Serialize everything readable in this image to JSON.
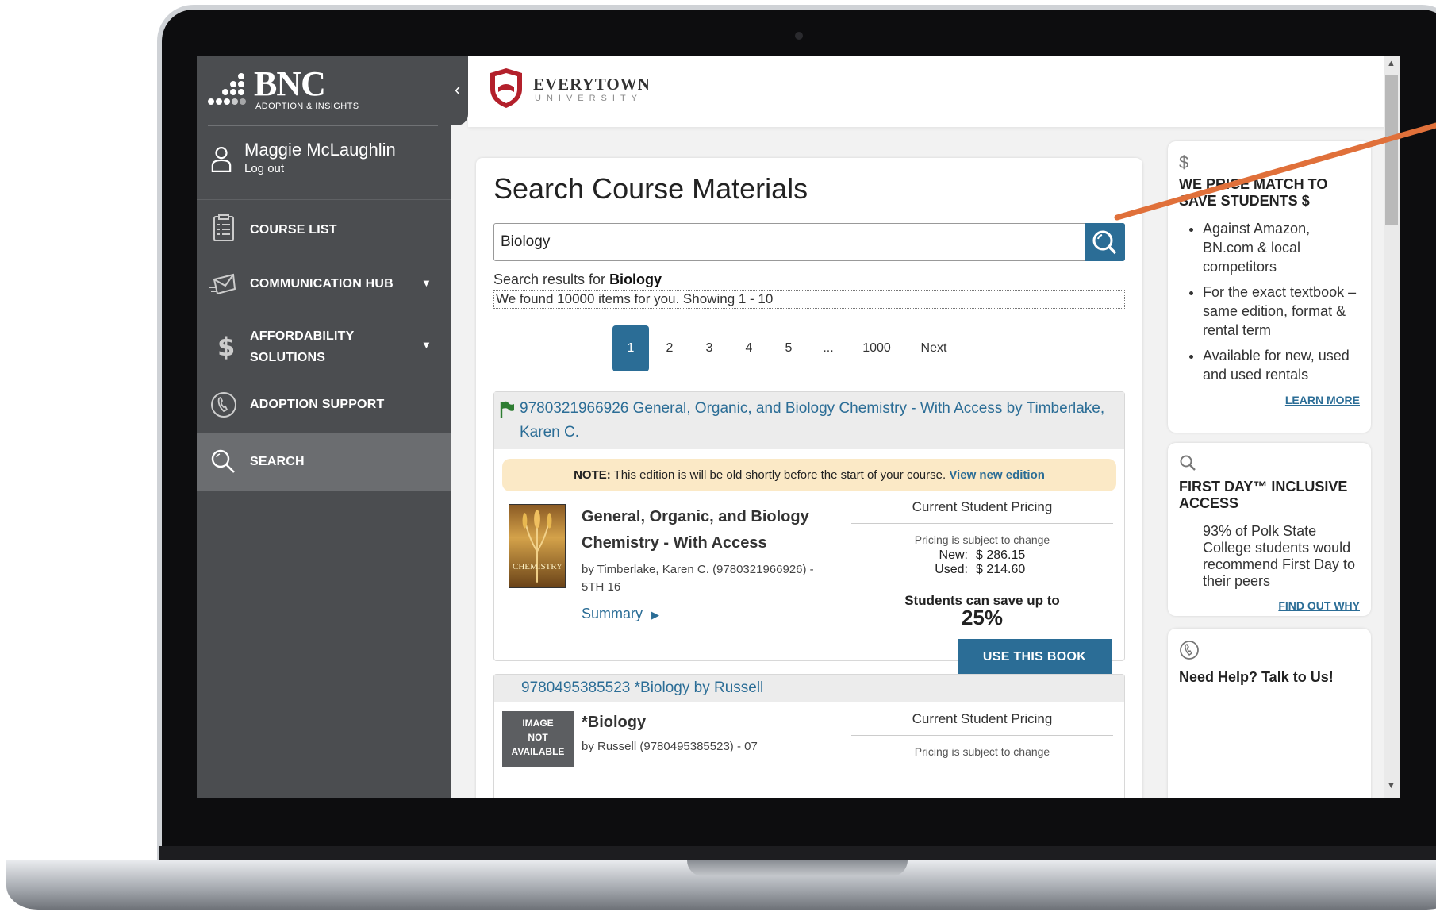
{
  "brand": {
    "name": "BNC",
    "subtitle": "ADOPTION & INSIGHTS"
  },
  "user": {
    "name": "Maggie McLaughlin",
    "logout": "Log out"
  },
  "nav": [
    {
      "label": "COURSE LIST",
      "icon": "clipboard-icon"
    },
    {
      "label": "COMMUNICATION HUB",
      "icon": "envelope-icon",
      "caret": "▼"
    },
    {
      "label_line1": "AFFORDABILITY",
      "label_line2": "SOLUTIONS",
      "icon": "dollar-icon",
      "caret": "▼"
    },
    {
      "label": "ADOPTION SUPPORT",
      "icon": "phone-icon"
    },
    {
      "label": "SEARCH",
      "icon": "search-icon"
    }
  ],
  "header": {
    "logo_word": "EVERYTOWN",
    "logo_sub": "UNIVERSITY"
  },
  "search": {
    "title": "Search Course Materials",
    "query": "Biology",
    "results_for_prefix": "Search results for ",
    "results_for_term": "Biology",
    "count_text": "We found 10000 items for you. Showing 1 - 10"
  },
  "pagination": {
    "pages": [
      "1",
      "2",
      "3",
      "4",
      "5",
      "...",
      "1000"
    ],
    "next": "Next",
    "current": "1"
  },
  "results": [
    {
      "head": "9780321966926 General, Organic, and Biology Chemistry - With Access by Timberlake, Karen C.",
      "note_bold": "NOTE:",
      "note_text": " This edition is will be old shortly before the start of your course. ",
      "note_link": "View new edition",
      "title": "General, Organic, and Biology Chemistry - With Access",
      "author": "by Timberlake, Karen C. (9780321966926) - 5TH 16",
      "cover_text": "CHEMISTRY",
      "summary": "Summary",
      "pricing_head": "Current Student Pricing",
      "pricing_sub": "Pricing is subject to change",
      "new_label": "New:",
      "new_price": "$ 286.15",
      "used_label": "Used:",
      "used_price": "$ 214.60",
      "save_text": "Students can save up to",
      "save_pct": "25%",
      "button": "USE THIS BOOK"
    },
    {
      "head": "9780495385523 *Biology by Russell",
      "no_image_1": "IMAGE",
      "no_image_2": "NOT",
      "no_image_3": "AVAILABLE",
      "title": "*Biology",
      "author": "by Russell (9780495385523) - 07",
      "pricing_head": "Current Student Pricing",
      "pricing_sub": "Pricing is subject to change"
    }
  ],
  "side": {
    "price_match": {
      "icon": "$",
      "title": "WE PRICE MATCH TO SAVE STUDENTS $",
      "items": [
        "Against Amazon, BN.com & local competitors",
        "For the exact textbook – same edition, format & rental term",
        "Available for new, used and used rentals"
      ],
      "link": "LEARN MORE"
    },
    "first_day": {
      "title": "FIRST DAY™ INCLUSIVE ACCESS",
      "body": "93% of Polk State College students would recommend First Day to their peers",
      "link": "FIND OUT WHY"
    },
    "help": {
      "title": "Need Help? Talk to Us!"
    }
  },
  "colors": {
    "accent": "#2b6d96",
    "sidebar": "#4b4d50",
    "note": "#fbe9c6",
    "annotation": "#e0703a"
  }
}
